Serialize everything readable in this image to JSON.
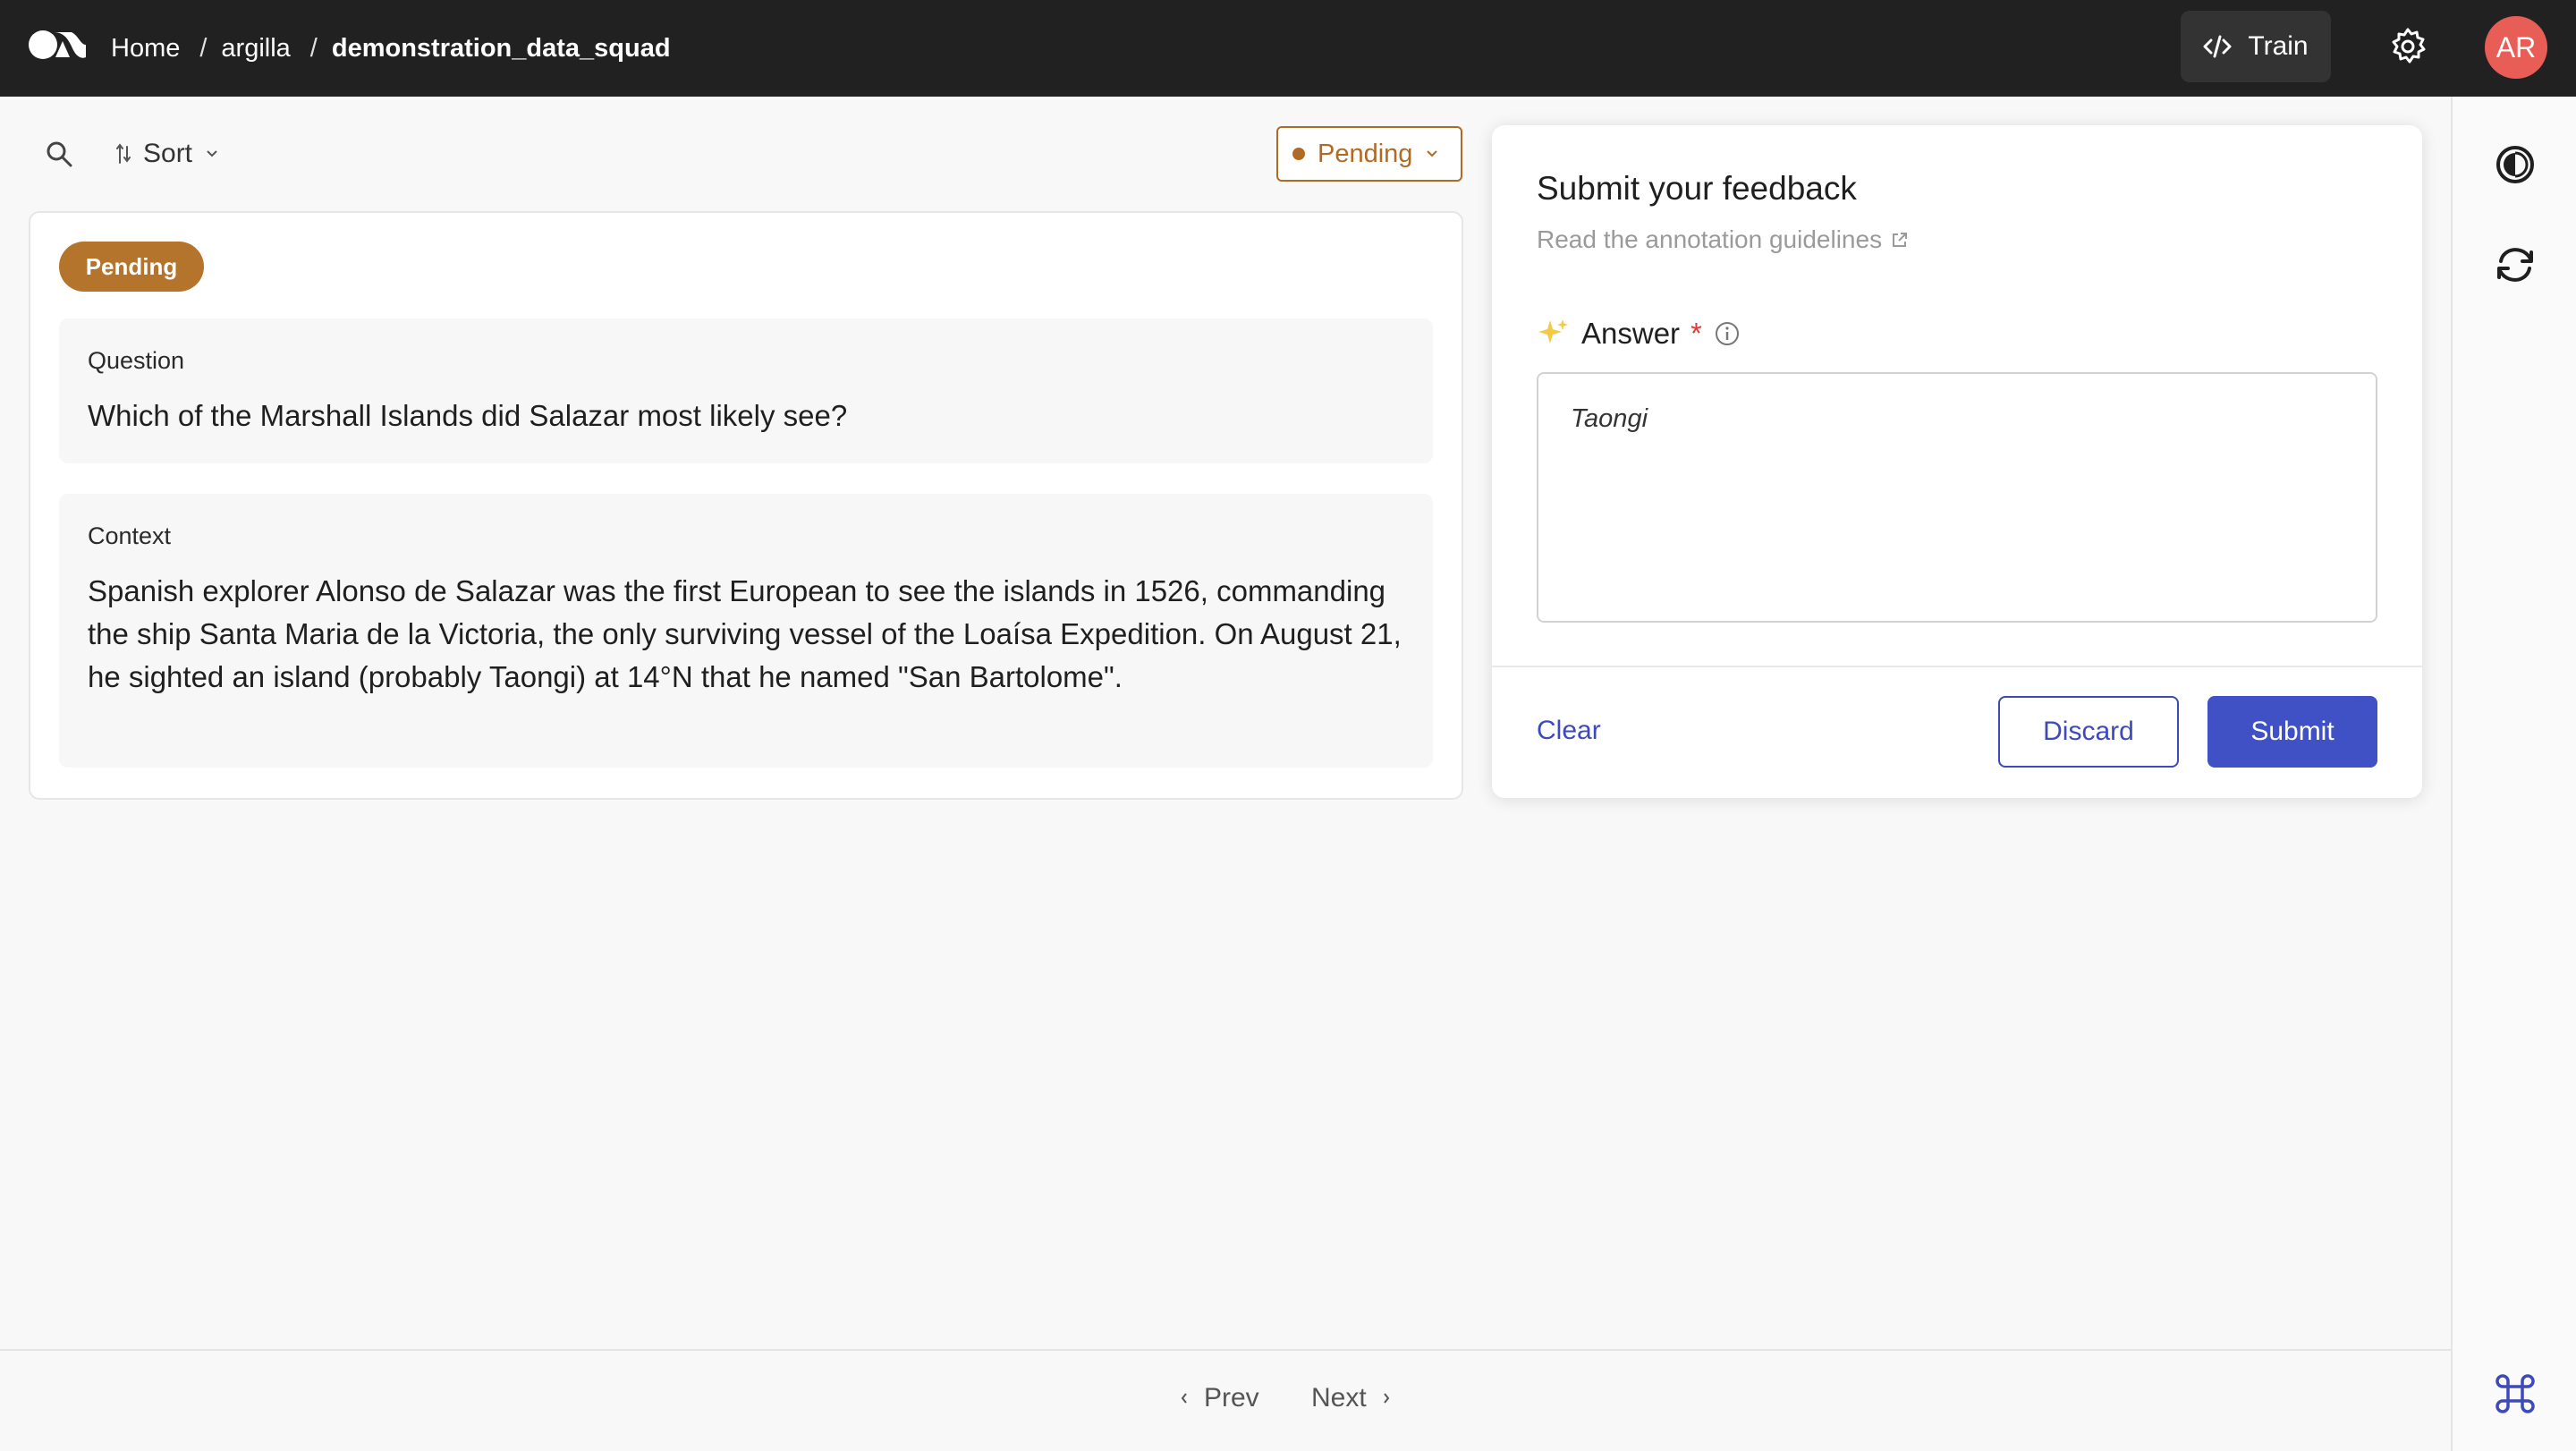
{
  "header": {
    "breadcrumb": [
      "Home",
      "argilla",
      "demonstration_data_squad"
    ],
    "train_label": "Train",
    "avatar_initials": "AR",
    "brand_color": "#212121"
  },
  "toolbar": {
    "sort_label": "Sort",
    "status_filter": "Pending",
    "status_color": "#b06a24"
  },
  "record": {
    "status_badge": "Pending",
    "fields": [
      {
        "title": "Question",
        "text": "Which of the Marshall Islands did Salazar most likely see?"
      },
      {
        "title": "Context",
        "text": "Spanish explorer Alonso de Salazar was the first European to see the islands in 1526, commanding the ship Santa Maria de la Victoria, the only surviving vessel of the Loaísa Expedition. On August 21, he sighted an island (probably Taongi) at 14°N that he named \"San Bartolome\"."
      }
    ]
  },
  "feedback": {
    "title": "Submit your feedback",
    "guidelines_link": "Read the annotation guidelines",
    "question_label": "Answer",
    "required_mark": "*",
    "answer_value": "Taongi",
    "clear_label": "Clear",
    "discard_label": "Discard",
    "submit_label": "Submit",
    "accent_color": "#3f51c4"
  },
  "pagination": {
    "prev_label": "Prev",
    "next_label": "Next"
  },
  "icons": [
    "logo-icon",
    "code-icon",
    "gear-icon",
    "search-icon",
    "sort-icon",
    "chevron-down-icon",
    "external-link-icon",
    "sparkles-icon",
    "info-icon",
    "contrast-icon",
    "refresh-icon",
    "command-icon",
    "chevron-left-icon",
    "chevron-right-icon"
  ]
}
